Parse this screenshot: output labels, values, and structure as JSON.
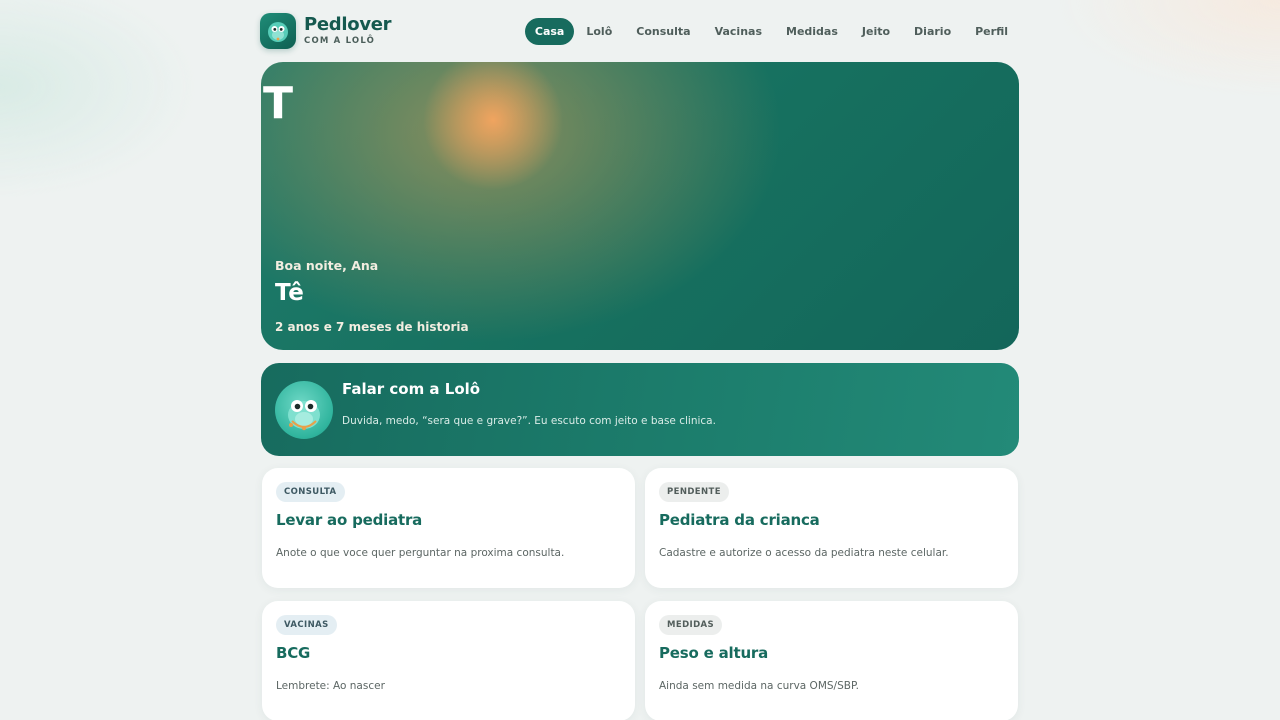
{
  "brand": {
    "name": "Pedlover",
    "subtitle": "COM A LOLÔ"
  },
  "nav": {
    "items": [
      {
        "label": "Casa",
        "active": true
      },
      {
        "label": "Lolô",
        "active": false
      },
      {
        "label": "Consulta",
        "active": false
      },
      {
        "label": "Vacinas",
        "active": false
      },
      {
        "label": "Medidas",
        "active": false
      },
      {
        "label": "Jeito",
        "active": false
      },
      {
        "label": "Diario",
        "active": false
      },
      {
        "label": "Perfil",
        "active": false
      }
    ]
  },
  "hero": {
    "photo_placeholder": "T",
    "greeting": "Boa noite, Ana",
    "child_name": "Tê",
    "age_text": "2 anos e 7 meses de historia"
  },
  "chat": {
    "title": "Falar com a Lolô",
    "description": "Duvida, medo, “sera que e grave?”. Eu escuto com jeito e base clinica."
  },
  "cards": [
    {
      "badge": "CONSULTA",
      "title": "Levar ao pediatra",
      "description": "Anote o que voce quer perguntar na proxima consulta."
    },
    {
      "badge": "PENDENTE",
      "title": "Pediatra da crianca",
      "description": "Cadastre e autorize o acesso da pediatra neste celular."
    },
    {
      "badge": "VACINAS",
      "title": "BCG",
      "description": "Lembrete: Ao nascer"
    },
    {
      "badge": "MEDIDAS",
      "title": "Peso e altura",
      "description": "Ainda sem medida na curva OMS/SBP."
    }
  ],
  "colors": {
    "brand": "#176b5e",
    "accent_orange": "#f0a45f",
    "background": "#eef2f1"
  },
  "icons": {
    "logo": "mascot-logo-icon",
    "mascot": "lolo-mascot-icon"
  }
}
